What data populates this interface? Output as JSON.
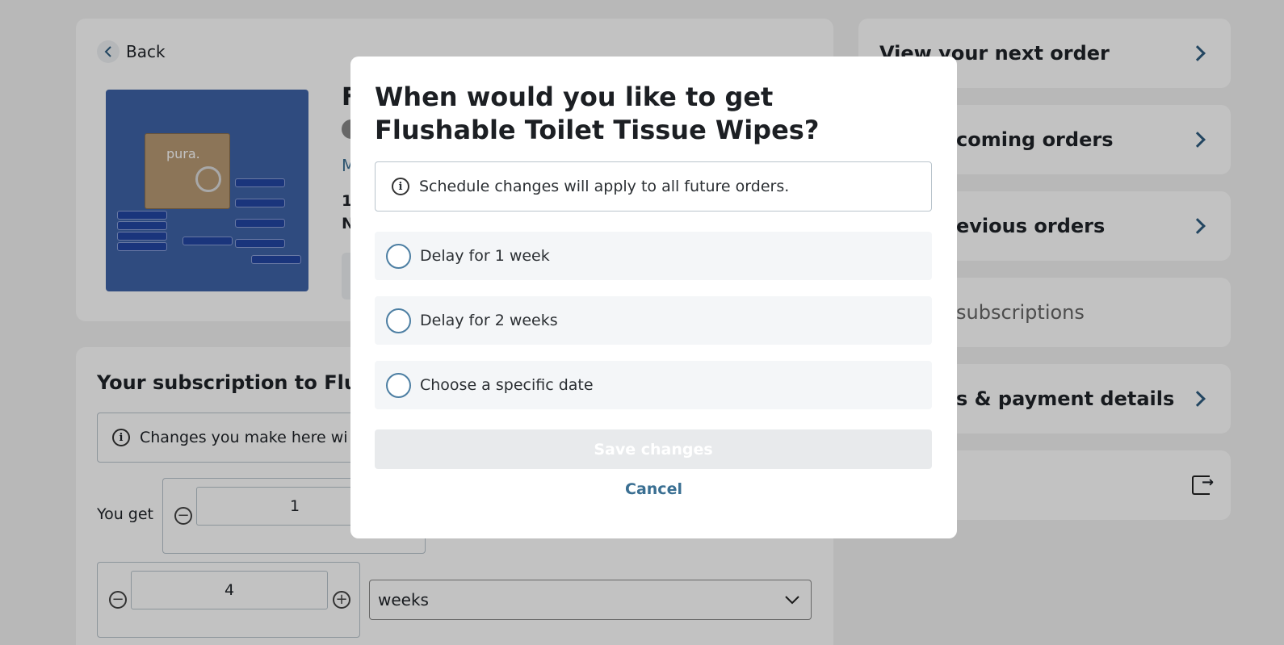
{
  "page": {
    "back_label": "Back",
    "product": {
      "title_partial": "F",
      "meta_partial_1": "M",
      "meta_partial_2": "1",
      "meta_partial_3": "N",
      "image_brand": "pura."
    },
    "subscription": {
      "title_partial": "Your subscription to Flush",
      "info_partial": "Changes you make here wi",
      "you_get_label": "You get",
      "quantity_value": "1",
      "interval_value": "4",
      "interval_unit": "weeks"
    }
  },
  "sidebar": {
    "items": [
      {
        "label": "View your next order",
        "has_chevron": true
      },
      {
        "label": "coming orders",
        "has_chevron": true
      },
      {
        "label": "evious orders",
        "has_chevron": true
      },
      {
        "label": "subscriptions",
        "has_chevron": false
      },
      {
        "label": "s & payment details",
        "has_chevron": true
      },
      {
        "label": "",
        "icon": "logout-icon"
      }
    ]
  },
  "modal": {
    "title": "When would you like to get Flushable Toilet Tissue Wipes?",
    "info_text": "Schedule changes will apply to all future orders.",
    "options": [
      {
        "label": "Delay for 1 week",
        "selected": false
      },
      {
        "label": "Delay for 2 weeks",
        "selected": false
      },
      {
        "label": "Choose a specific date",
        "selected": false
      }
    ],
    "save_label": "Save changes",
    "cancel_label": "Cancel"
  },
  "colors": {
    "accent": "#3a6f92",
    "overlay": "rgba(0,0,0,0.24)",
    "option_bg": "#f4f6f8",
    "disabled_button": "#e8eaec"
  }
}
